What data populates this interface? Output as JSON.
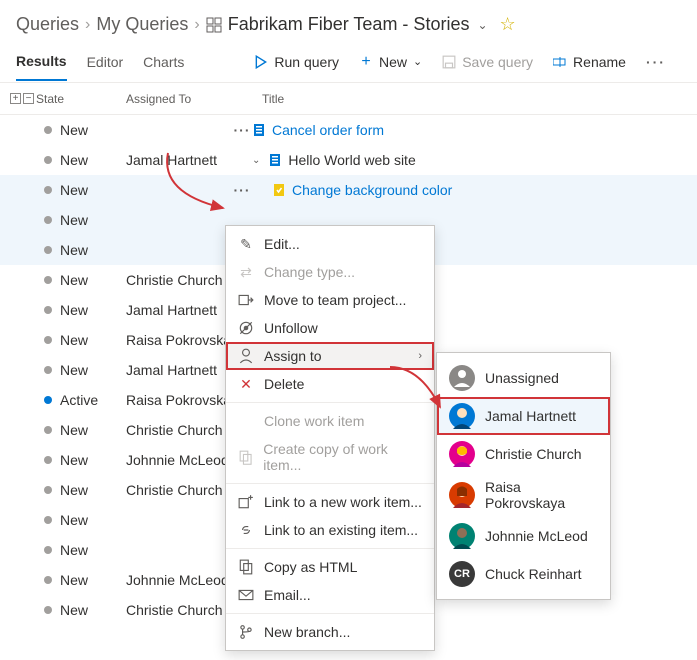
{
  "breadcrumb": {
    "root": "Queries",
    "mid": "My Queries",
    "current": "Fabrikam Fiber Team - Stories"
  },
  "tabs": {
    "results": "Results",
    "editor": "Editor",
    "charts": "Charts"
  },
  "toolbar": {
    "run": "Run query",
    "new": "New",
    "save": "Save query",
    "rename": "Rename"
  },
  "columns": {
    "state": "State",
    "assigned": "Assigned To",
    "title": "Title"
  },
  "rows": [
    {
      "state": "New",
      "dot": "gray",
      "assigned": "",
      "ell": true,
      "titleType": "link",
      "icon": "pbi",
      "title": "Cancel order form",
      "indent": 0
    },
    {
      "state": "New",
      "dot": "gray",
      "assigned": "Jamal Hartnett",
      "ell": false,
      "titleType": "plain",
      "icon": "pbi",
      "title": "Hello World web site",
      "indent": 0,
      "expand": true
    },
    {
      "state": "New",
      "dot": "gray",
      "assigned": "",
      "ell": true,
      "titleType": "link",
      "icon": "task",
      "title": "Change background color",
      "indent": 1,
      "selected": true
    },
    {
      "state": "New",
      "dot": "gray",
      "assigned": "",
      "ell": false,
      "titleType": "",
      "icon": "",
      "title": "",
      "indent": 0,
      "selected": true
    },
    {
      "state": "New",
      "dot": "gray",
      "assigned": "",
      "ell": false,
      "titleType": "",
      "icon": "",
      "title": "",
      "indent": 0,
      "selected": true
    },
    {
      "state": "New",
      "dot": "gray",
      "assigned": "Christie Church",
      "ell": false,
      "titleType": "",
      "icon": "",
      "title": "",
      "indent": 0
    },
    {
      "state": "New",
      "dot": "gray",
      "assigned": "Jamal Hartnett",
      "ell": false,
      "titleType": "",
      "icon": "",
      "title": "",
      "indent": 0
    },
    {
      "state": "New",
      "dot": "gray",
      "assigned": "Raisa Pokrovska",
      "ell": false,
      "titleType": "",
      "icon": "",
      "title": "",
      "indent": 0
    },
    {
      "state": "New",
      "dot": "gray",
      "assigned": "Jamal Hartnett",
      "ell": false,
      "titleType": "",
      "icon": "",
      "title": "",
      "indent": 0
    },
    {
      "state": "Active",
      "dot": "active",
      "assigned": "Raisa Pokrovska",
      "ell": false,
      "titleType": "",
      "icon": "",
      "title": "",
      "indent": 0
    },
    {
      "state": "New",
      "dot": "gray",
      "assigned": "Christie Church",
      "ell": false,
      "titleType": "",
      "icon": "",
      "title": "",
      "indent": 0
    },
    {
      "state": "New",
      "dot": "gray",
      "assigned": "Johnnie McLeod",
      "ell": false,
      "titleType": "",
      "icon": "",
      "title": "",
      "indent": 0
    },
    {
      "state": "New",
      "dot": "gray",
      "assigned": "Christie Church",
      "ell": false,
      "titleType": "",
      "icon": "",
      "title": "",
      "indent": 0
    },
    {
      "state": "New",
      "dot": "gray",
      "assigned": "",
      "ell": false,
      "titleType": "",
      "icon": "",
      "title": "",
      "indent": 0
    },
    {
      "state": "New",
      "dot": "gray",
      "assigned": "",
      "ell": false,
      "titleType": "",
      "icon": "",
      "title": "",
      "indent": 0
    },
    {
      "state": "New",
      "dot": "gray",
      "assigned": "Johnnie McLeod",
      "ell": false,
      "titleType": "",
      "icon": "",
      "title": "",
      "indent": 0
    },
    {
      "state": "New",
      "dot": "gray",
      "assigned": "Christie Church",
      "ell": false,
      "titleType": "",
      "icon": "",
      "title": "",
      "indent": 0
    }
  ],
  "ctx": {
    "edit": "Edit...",
    "changeType": "Change type...",
    "move": "Move to team project...",
    "unfollow": "Unfollow",
    "assign": "Assign to",
    "delete": "Delete",
    "clone": "Clone work item",
    "copy": "Create copy of work item...",
    "link_new": "Link to a new work item...",
    "link_existing": "Link to an existing item...",
    "copy_html": "Copy as HTML",
    "email": "Email...",
    "branch": "New branch..."
  },
  "assignees": {
    "unassigned": "Unassigned",
    "jamal": "Jamal Hartnett",
    "christie": "Christie Church",
    "raisa": "Raisa Pokrovskaya",
    "johnnie": "Johnnie McLeod",
    "chuck": "Chuck Reinhart",
    "chuck_initials": "CR"
  }
}
